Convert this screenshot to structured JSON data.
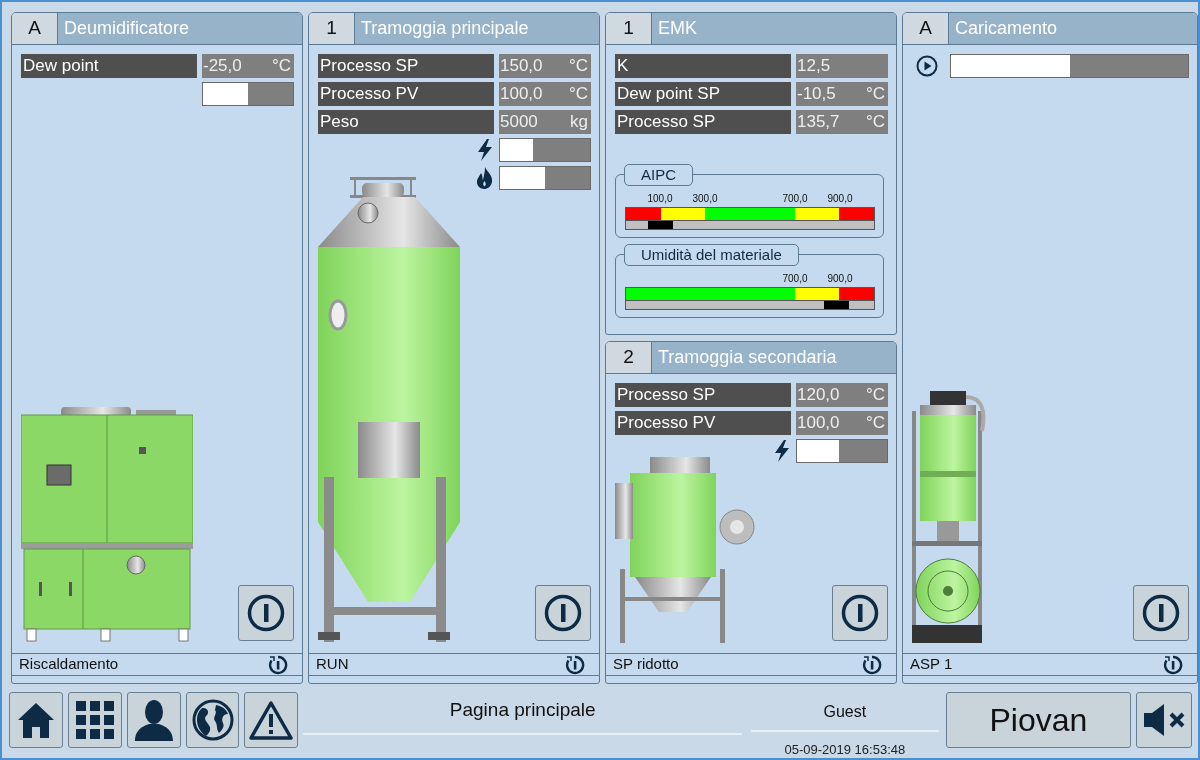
{
  "columns": [
    {
      "panels": [
        {
          "tag": "A",
          "title": "Deumidificatore",
          "rows": [
            {
              "label": "Dew point",
              "value": "-25,0",
              "unit": "°C"
            }
          ],
          "bars": [
            {
              "kind": "plain",
              "level": 0.5
            }
          ],
          "machine": {
            "kind": "dryer"
          },
          "status": "Riscaldamento"
        }
      ]
    },
    {
      "panels": [
        {
          "tag": "1",
          "title": "Tramoggia principale",
          "rows": [
            {
              "label": "Processo SP",
              "value": "150,0",
              "unit": "°C"
            },
            {
              "label": "Processo PV",
              "value": "100,0",
              "unit": "°C"
            },
            {
              "label": "Peso",
              "value": "5000",
              "unit": "kg"
            }
          ],
          "bars": [
            {
              "kind": "power",
              "level": 0.37
            },
            {
              "kind": "flame",
              "level": 0.5
            }
          ],
          "machine": {
            "kind": "hopper"
          },
          "status": "RUN"
        }
      ]
    },
    {
      "panels": [
        {
          "tag": "1",
          "title": "EMK",
          "rows": [
            {
              "label": "K",
              "value": "12,5"
            },
            {
              "label": "Dew point SP",
              "value": "-10,5",
              "unit": "°C"
            },
            {
              "label": "Processo SP",
              "value": "135,7",
              "unit": "°C"
            }
          ],
          "gauges": [
            {
              "title": "AIPC",
              "marker": {
                "level": 0.14
              },
              "ticks": [
                {
                  "label": "100,0",
                  "level": 0.14
                },
                {
                  "label": "300,0",
                  "level": 0.32
                },
                {
                  "label": "700,0",
                  "level": 0.68
                },
                {
                  "label": "900,0",
                  "level": 0.86
                }
              ],
              "zones": [
                {
                  "color": "#ff0000"
                },
                {
                  "color": "#ffff00"
                },
                {
                  "color": "#00ff00"
                },
                {
                  "color": "#ffff00"
                },
                {
                  "color": "#ff0000"
                }
              ]
            },
            {
              "title": "Umidità del materiale",
              "marker": {
                "level": 0.85
              },
              "ticks": [
                {
                  "label": "700,0",
                  "level": 0.68
                },
                {
                  "label": "900,0",
                  "level": 0.86
                }
              ],
              "zones": [
                {
                  "color": "#00ff00"
                },
                {
                  "color": "#ffff00"
                },
                {
                  "color": "#ff0000"
                }
              ]
            }
          ]
        },
        {
          "tag": "2",
          "title": "Tramoggia secondaria",
          "rows": [
            {
              "label": "Processo SP",
              "value": "120,0",
              "unit": "°C"
            },
            {
              "label": "Processo PV",
              "value": "100,0",
              "unit": "°C"
            }
          ],
          "bars": [
            {
              "kind": "power",
              "level": 0.47
            }
          ],
          "machine": {
            "kind": "small-hopper"
          },
          "status": "SP ridotto"
        }
      ]
    },
    {
      "panels": [
        {
          "tag": "A",
          "title": "Caricamento",
          "bars": [
            {
              "kind": "play",
              "level": 0.5
            }
          ],
          "machine": {
            "kind": "loader"
          },
          "status": "ASP 1"
        }
      ]
    }
  ],
  "bottom_bar": {
    "page_title": "Pagina principale",
    "user": "Guest",
    "datetime": "05-09-2019 16:53:48",
    "brand_button": "Piovan"
  }
}
